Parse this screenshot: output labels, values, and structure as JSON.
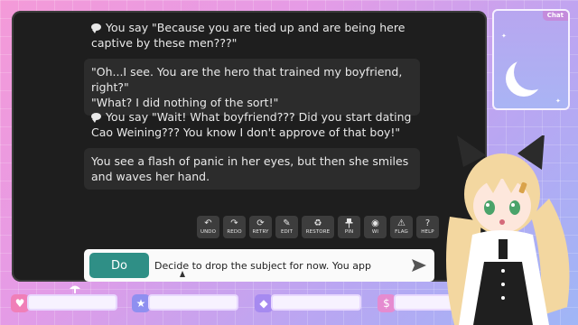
{
  "messages": [
    {
      "type": "you",
      "text": "You say \"Because you are tied up and are being here captive by these men???\""
    },
    {
      "type": "ai",
      "line1": "\"Oh...I see. You are the hero that trained my boyfriend, right?\"",
      "line2": "\"What? I did nothing of the sort!\""
    },
    {
      "type": "you",
      "text": "You say \"Wait! What boyfriend??? Did you start dating Cao Weining??? You know I don't approve of that boy!\""
    },
    {
      "type": "ai",
      "text": "You see a flash of panic in her eyes, but then she smiles and waves her hand."
    }
  ],
  "toolbar": [
    {
      "label": "UNDO",
      "icon": "undo-icon",
      "glyph": "↶"
    },
    {
      "label": "REDO",
      "icon": "redo-icon",
      "glyph": "↷"
    },
    {
      "label": "RETRY",
      "icon": "retry-icon",
      "glyph": "⟳"
    },
    {
      "label": "EDIT",
      "icon": "edit-icon",
      "glyph": "✎"
    },
    {
      "label": "RESTORE",
      "icon": "restore-icon",
      "glyph": "♻"
    },
    {
      "label": "PIN",
      "icon": "pin-icon",
      "glyph": "📌"
    },
    {
      "label": "WI",
      "icon": "world-info-icon",
      "glyph": "◉"
    },
    {
      "label": "FLAG",
      "icon": "flag-icon",
      "glyph": "⚠"
    },
    {
      "label": "HELP",
      "icon": "help-icon",
      "glyph": "?"
    }
  ],
  "input": {
    "mode_label": "Do",
    "value": "Decide to drop the subject for now. You app"
  },
  "chat_widget": {
    "tab_label": "Chat"
  },
  "colors": {
    "accent": "#2f8f86",
    "panel": "#1e1e1e",
    "bubble": "#2c2c2c",
    "heart_icon": "#f07fb8",
    "star_icon": "#8f8ff0",
    "gem_icon": "#a68af0",
    "dollar_icon": "#e58bd0"
  },
  "status_icons": [
    "heart-icon",
    "star-icon",
    "gem-icon",
    "dollar-icon"
  ]
}
